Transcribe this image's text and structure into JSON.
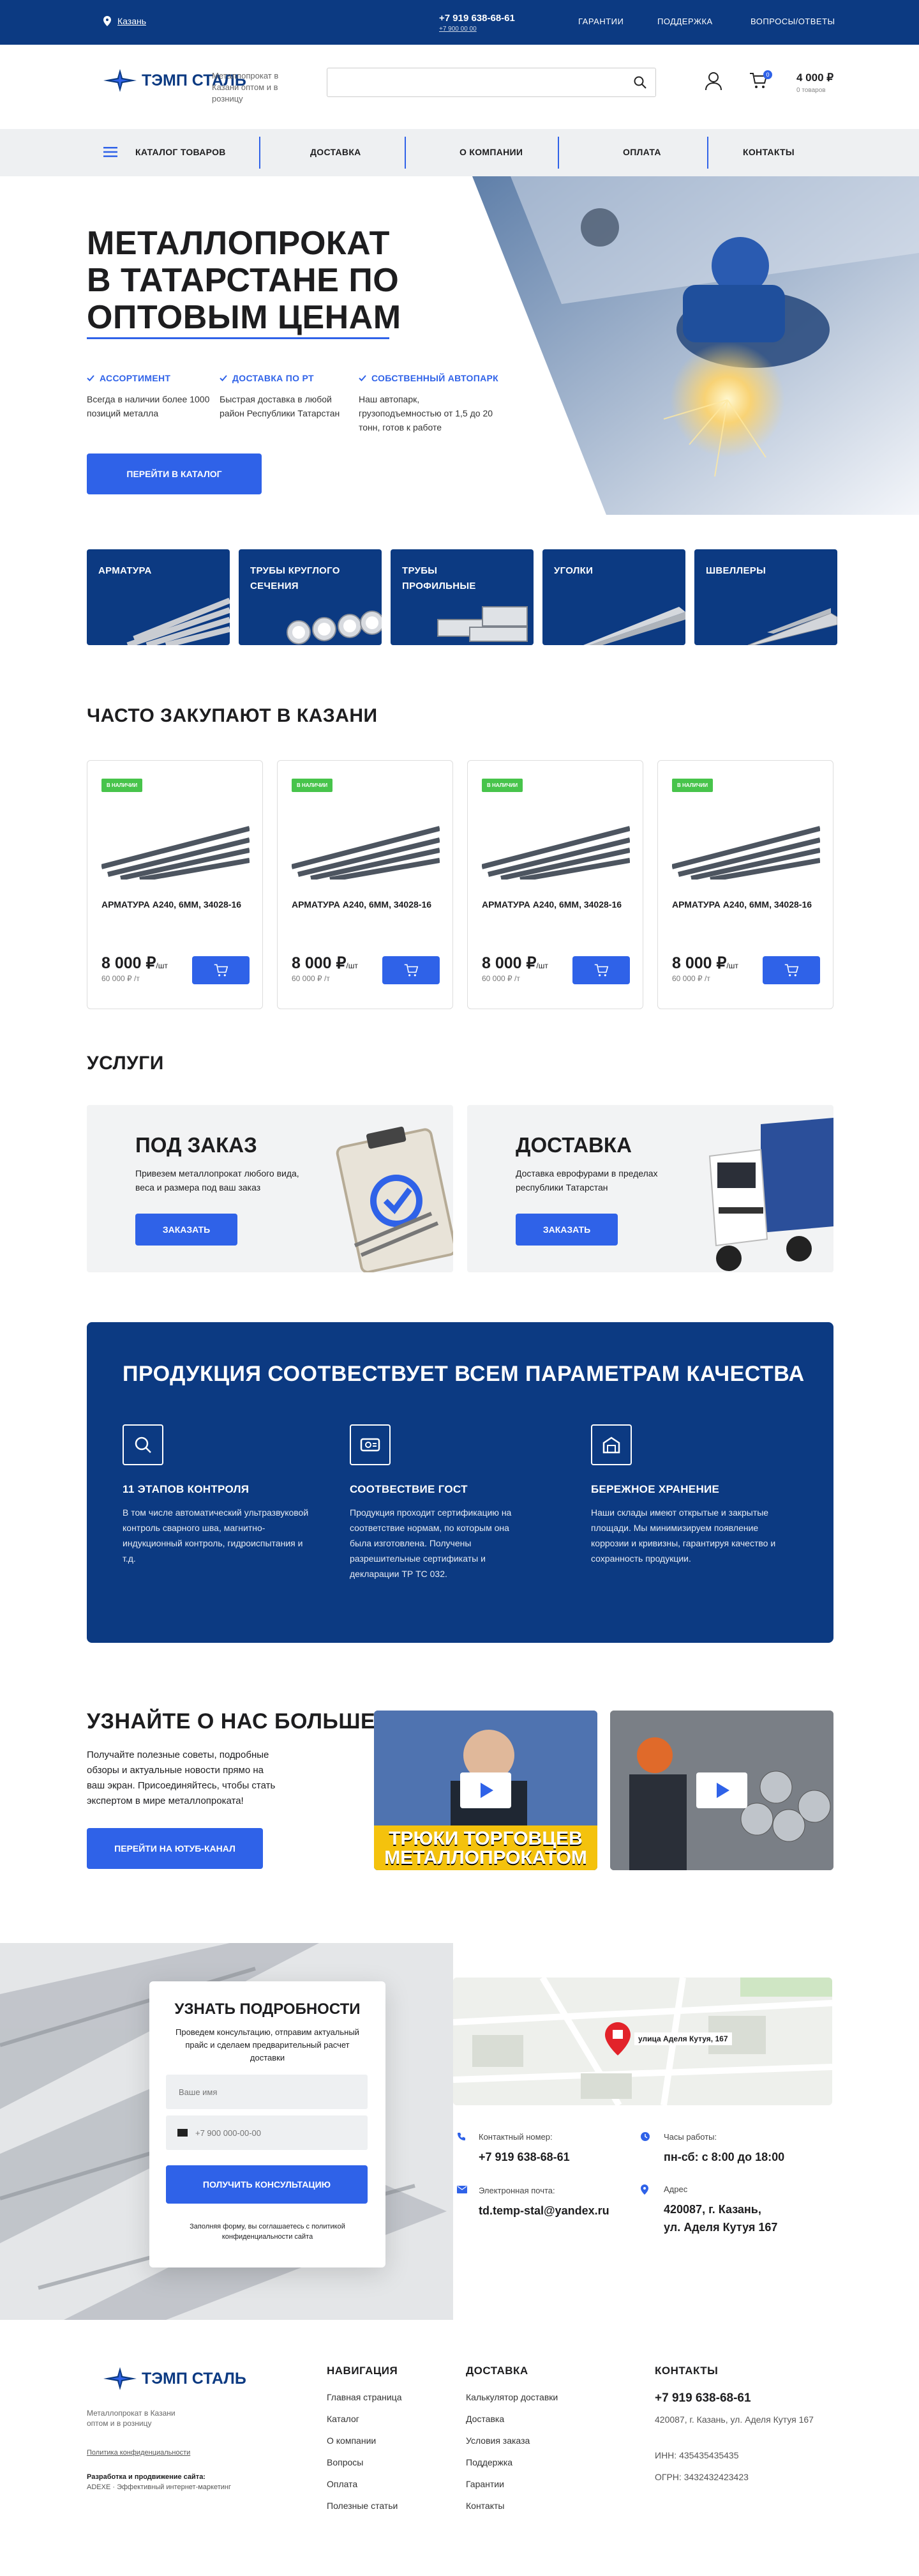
{
  "topbar": {
    "city": "Казань",
    "phone": "+7 919 638-68-61",
    "callback": "+7 900 00 00",
    "links": [
      "ГАРАНТИИ",
      "ПОДДЕРЖКА",
      "ВОПРОСЫ/ОТВЕТЫ"
    ]
  },
  "header": {
    "logo": "ТЭМП СТАЛЬ",
    "tagline": "Металлопрокат в Казани оптом и в розницу",
    "search_placeholder": "",
    "cart_count": "0",
    "cart_sum": "4 000 ₽",
    "cart_sub": "0 товаров"
  },
  "nav": {
    "items": [
      "КАТАЛОГ ТОВАРОВ",
      "ДОСТАВКА",
      "О КОМПАНИИ",
      "ОПЛАТА",
      "КОНТАКТЫ"
    ]
  },
  "hero": {
    "title_l1": "МЕТАЛЛОПРОКАТ",
    "title_l2": "В ТАТАРСТАНЕ ПО",
    "title_l3": "ОПТОВЫМ ЦЕНАМ",
    "features": [
      {
        "t": "АССОРТИМЕНТ",
        "d": "Всегда в наличии более 1000 позиций металла"
      },
      {
        "t": "ДОСТАВКА ПО РТ",
        "d": "Быстрая доставка в любой район Республики Татарстан"
      },
      {
        "t": "СОБСТВЕННЫЙ АВТОПАРК",
        "d": "Наш автопарк, грузоподъемностью от 1,5 до 20 тонн, готов к работе"
      }
    ],
    "button": "ПЕРЕЙТИ В КАТАЛОГ"
  },
  "categories": [
    {
      "l1": "АРМАТУРА",
      "l2": ""
    },
    {
      "l1": "ТРУБЫ КРУГЛОГО",
      "l2": "СЕЧЕНИЯ"
    },
    {
      "l1": "ТРУБЫ",
      "l2": "ПРОФИЛЬНЫЕ"
    },
    {
      "l1": "УГОЛКИ",
      "l2": ""
    },
    {
      "l1": "ШВЕЛЛЕРЫ",
      "l2": ""
    }
  ],
  "popular": {
    "title": "ЧАСТО ЗАКУПАЮТ В КАЗАНИ",
    "products": [
      {
        "badge": "В НАЛИЧИИ",
        "name": "АРМАТУРА А240, 6ММ, 34028-16",
        "price": "8 000 ₽",
        "unit": "/шт",
        "price2": "60 000 ₽ /т"
      },
      {
        "badge": "В НАЛИЧИИ",
        "name": "АРМАТУРА А240, 6ММ, 34028-16",
        "price": "8 000 ₽",
        "unit": "/шт",
        "price2": "60 000 ₽ /т"
      },
      {
        "badge": "В НАЛИЧИИ",
        "name": "АРМАТУРА А240, 6ММ, 34028-16",
        "price": "8 000 ₽",
        "unit": "/шт",
        "price2": "60 000 ₽ /т"
      },
      {
        "badge": "В НАЛИЧИИ",
        "name": "АРМАТУРА А240, 6ММ, 34028-16",
        "price": "8 000 ₽",
        "unit": "/шт",
        "price2": "60 000 ₽ /т"
      }
    ]
  },
  "services": {
    "title": "УСЛУГИ",
    "items": [
      {
        "t": "ПОД ЗАКАЗ",
        "d": "Привезем металлопрокат любого вида, веса и размера под ваш заказ",
        "b": "ЗАКАЗАТЬ"
      },
      {
        "t": "ДОСТАВКА",
        "d": "Доставка еврофурами в пределах республики Татарстан",
        "b": "ЗАКАЗАТЬ"
      }
    ]
  },
  "quality": {
    "title": "ПРОДУКЦИЯ СООТВЕСТВУЕТ ВСЕМ ПАРАМЕТРАМ КАЧЕСТВА",
    "items": [
      {
        "t": "11 ЭТАПОВ КОНТРОЛЯ",
        "d": "В том числе автоматический ультразвуковой контроль сварного шва, магнитно-индукционный контроль, гидроиспытания и т.д."
      },
      {
        "t": "СООТВЕСТВИЕ ГОСТ",
        "d": "Продукция проходит сертификацию на соответствие нормам, по которым она была изготовлена. Получены разрешительные сертификаты и декларации ТР ТС 032."
      },
      {
        "t": "БЕРЕЖНОЕ ХРАНЕНИЕ",
        "d": "Наши склады имеют открытые и закрытые площади. Мы минимизируем появление коррозии и кривизны, гарантируя качество и сохранность продукции."
      }
    ]
  },
  "learn": {
    "title": "УЗНАЙТЕ О НАС БОЛЬШЕ",
    "desc": "Получайте полезные советы, подробные обзоры и актуальные новости прямо на ваш экран. Присоединяйтесь, чтобы стать экспертом в мире металлопроката!",
    "button": "ПЕРЕЙТИ НА ЮТУБ-КАНАЛ",
    "video1_caption": "ТРЮКИ ТОРГОВЦЕВ МЕТАЛЛОПРОКАТОМ"
  },
  "form": {
    "title": "УЗНАТЬ ПОДРОБНОСТИ",
    "desc": "Проведем консультацию, отправим актуальный прайс и сделаем предварительный расчет доставки",
    "name_ph": "Ваше имя",
    "phone_ph": "+7 900 000-00-00",
    "button": "ПОЛУЧИТЬ КОНСУЛЬТАЦИЮ",
    "note": "Заполняя форму, вы соглашаетесь с политикой конфиденциальности сайта"
  },
  "map": {
    "label": "улица Аделя Кутуя, 167"
  },
  "contacts": {
    "phone_l": "Контактный номер:",
    "phone": "+7 919 638-68-61",
    "hours_l": "Часы работы:",
    "hours": "пн-сб: с 8:00 до 18:00",
    "email_l": "Электронная почта:",
    "email": "td.temp-stal@yandex.ru",
    "addr_l": "Адрес",
    "addr1": "420087, г. Казань,",
    "addr2": "ул. Аделя Кутуя 167"
  },
  "footer": {
    "logo": "ТЭМП СТАЛЬ",
    "tagline": "Металлопрокат в Казани оптом и в розницу",
    "policy": "Политика конфиденциальности",
    "dev_l": "Разработка и продвижение сайта:",
    "dev": "ADEXE · Эффективный интернет-маркетинг",
    "nav_h": "НАВИГАЦИЯ",
    "nav": [
      "Главная страница",
      "Каталог",
      "О компании",
      "Вопросы",
      "Оплата",
      "Полезные статьи"
    ],
    "del_h": "ДОСТАВКА",
    "del": [
      "Калькулятор доставки",
      "Доставка",
      "Условия заказа",
      "Поддержка",
      "Гарантии",
      "Контакты"
    ],
    "cont_h": "КОНТАКТЫ",
    "phone": "+7 919 638-68-61",
    "addr": "420087, г. Казань, ул. Аделя Кутуя 167",
    "inn": "ИНН: 435435435435",
    "ogrn": "ОГРН: 3432432423423"
  },
  "colors": {
    "primary": "#0c3a82",
    "accent": "#2f62e8",
    "badge": "#47c44b"
  }
}
